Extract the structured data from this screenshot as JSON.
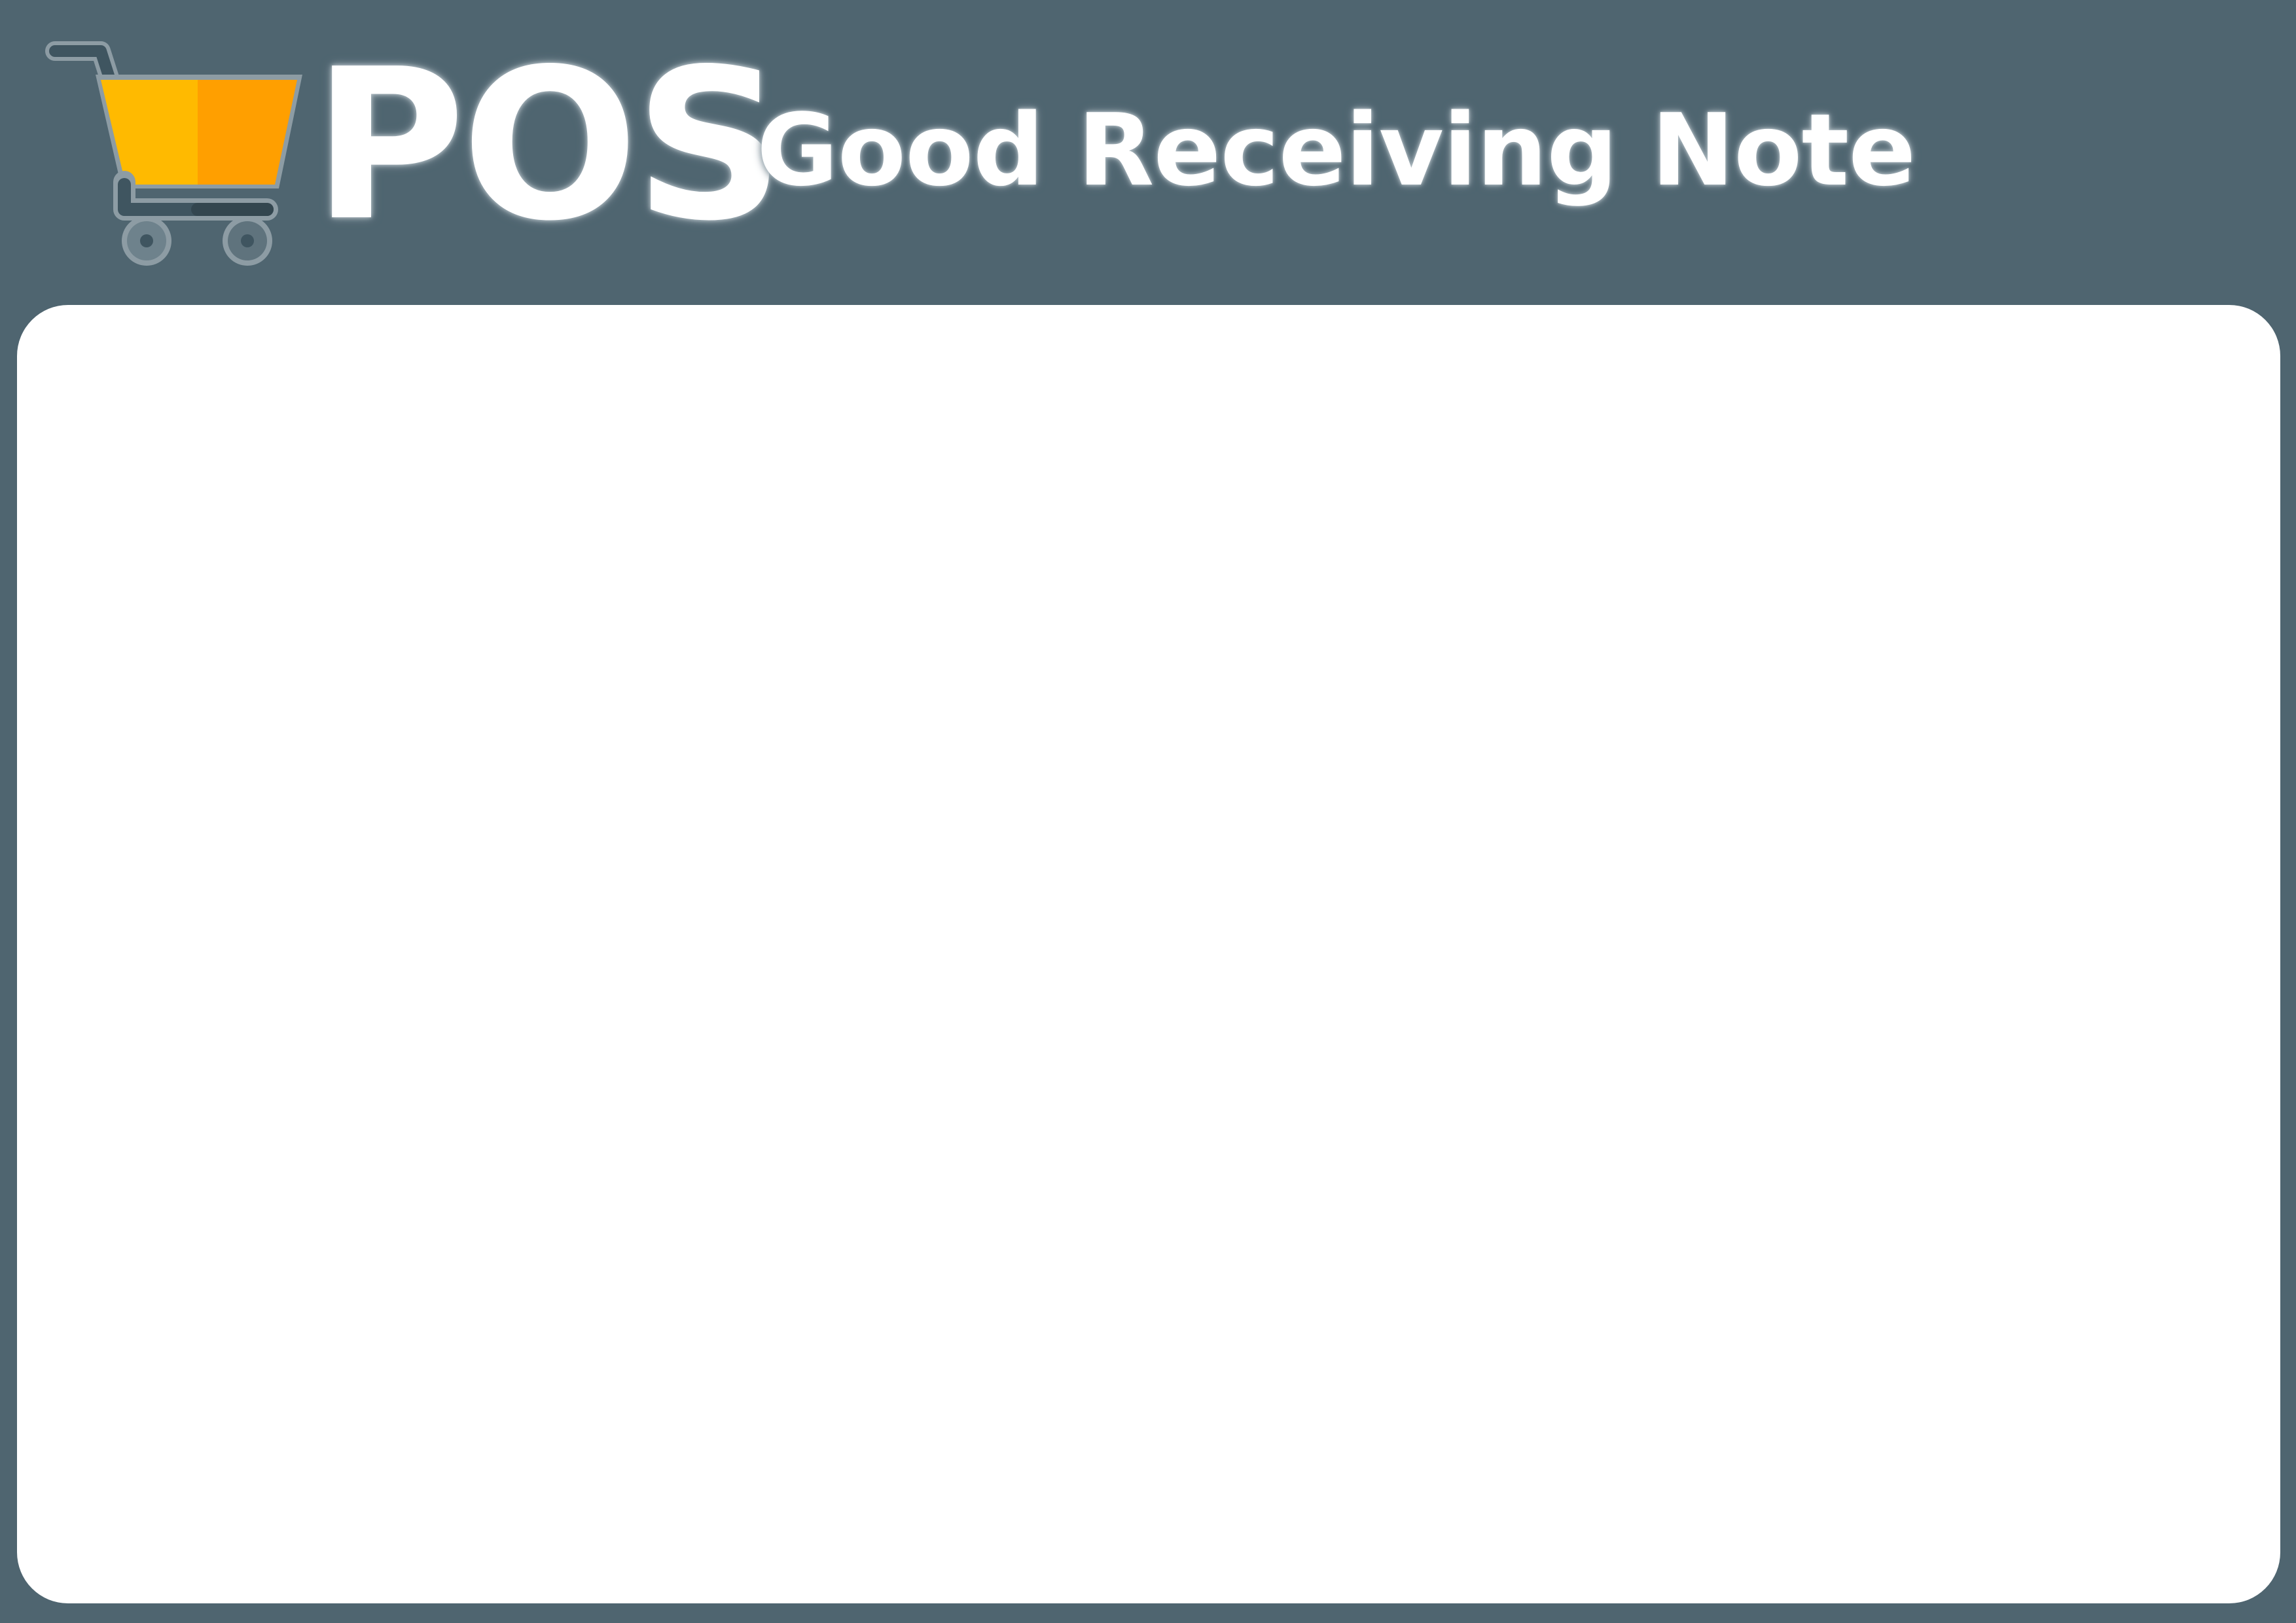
{
  "header": {
    "brand": "POS",
    "document_title": "Good Receiving Note",
    "logo_icon": "shopping-cart-icon"
  },
  "colors": {
    "background": "#4f6570",
    "panel": "#ffffff",
    "cart_basket_left": "#ffba00",
    "cart_basket_right": "#ff9f00",
    "cart_frame": "#3f5560",
    "cart_wheels": "#6e828c",
    "text": "#ffffff"
  },
  "content": {
    "body": ""
  }
}
